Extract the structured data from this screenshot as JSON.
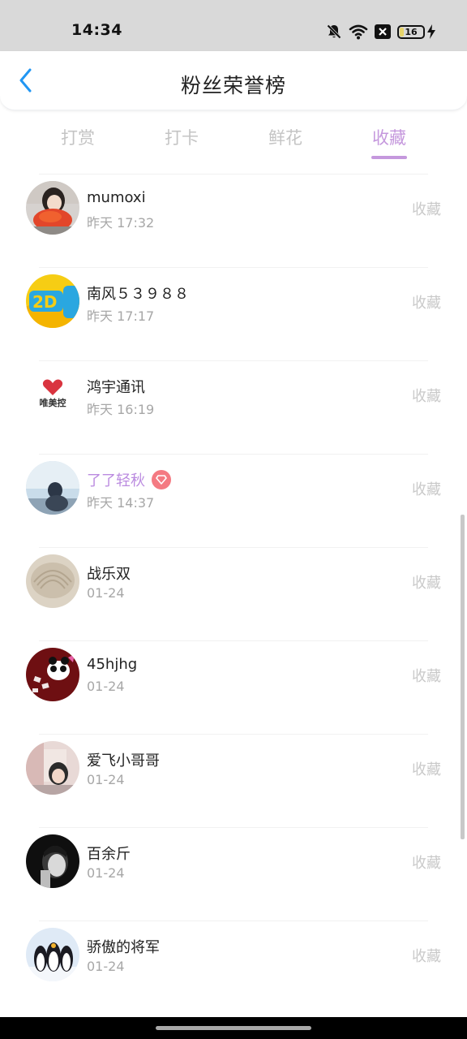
{
  "status_bar": {
    "time": "14:34",
    "icons": [
      "bell-off-icon",
      "wifi-icon",
      "close-box-icon",
      "battery-icon",
      "charging-bolt-icon"
    ],
    "battery_level": "16"
  },
  "header": {
    "title": "粉丝荣誉榜",
    "back_icon": "chevron-left-icon",
    "back_color": "#2196f3"
  },
  "tabs": {
    "items": [
      {
        "label": "打赏"
      },
      {
        "label": "打卡"
      },
      {
        "label": "鲜花"
      },
      {
        "label": "收藏"
      }
    ],
    "active_index": 3,
    "active_color": "#c598dd"
  },
  "fans": [
    {
      "name": "mumoxi",
      "time": "昨天 17:32",
      "action": "收藏"
    },
    {
      "name": "南风５３９８８",
      "time": "昨天 17:17",
      "action": "收藏"
    },
    {
      "name": "鸿宇通讯",
      "time": "昨天 16:19",
      "action": "收藏",
      "avatar_text": "唯美控"
    },
    {
      "name": "了了轻秋",
      "time": "昨天 14:37",
      "action": "收藏",
      "vip": true
    },
    {
      "name": "战乐双",
      "time": "01-24",
      "action": "收藏"
    },
    {
      "name": "45hjhg",
      "time": "01-24",
      "action": "收藏"
    },
    {
      "name": "爱飞小哥哥",
      "time": "01-24",
      "action": "收藏"
    },
    {
      "name": "百余斤",
      "time": "01-24",
      "action": "收藏"
    },
    {
      "name": "骄傲的将军",
      "time": "01-24",
      "action": "收藏"
    }
  ]
}
